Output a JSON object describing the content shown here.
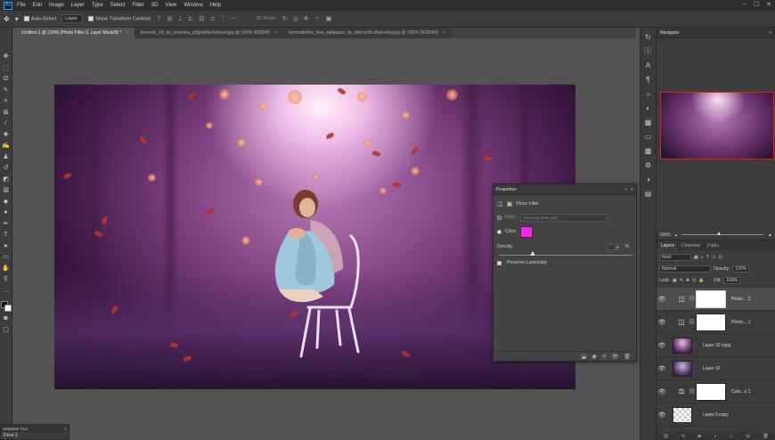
{
  "app": {
    "logo": "Ps"
  },
  "menu": [
    "File",
    "Edit",
    "Image",
    "Layer",
    "Type",
    "Select",
    "Filter",
    "3D",
    "View",
    "Window",
    "Help"
  ],
  "window_controls": [
    "–",
    "☐",
    "✕"
  ],
  "options": {
    "auto_select": "Auto-Select",
    "target": "Layer",
    "show_transform": "Show Transform Controls",
    "mode_3d": "3D Mode:"
  },
  "tabs": [
    {
      "label": "Untitled-1 @ 100% (Photo Filter 2, Layer Mask/8) *",
      "active": true
    },
    {
      "label": "firework_(4)_by_snoeska_d2jpeb8a-fullview.jpg @ 100% (RGB/8)",
      "active": false
    },
    {
      "label": "cinematicfire_free_wallpaper_by_bilbcart8-d5pkmrkg.jpg @ 100% (RGB/8#)",
      "active": false
    }
  ],
  "properties": {
    "title": "Properties",
    "subtitle": "Photo Filter",
    "filter_label": "Filter:",
    "filter_value": "Warming Filter (85)",
    "color_label": "Color:",
    "density_label": "Density:",
    "density_value": "25",
    "density_unit": "%",
    "density_level": 0.25,
    "preserve": "Preserve Luminosity",
    "color_hex": "#ff22ee"
  },
  "navigator": {
    "title": "Navigator",
    "zoom": "100%"
  },
  "layers_panel": {
    "tabs": [
      "Layers",
      "Channels",
      "Paths"
    ],
    "kind": "Kind",
    "blend": "Normal",
    "opacity_label": "Opacity:",
    "opacity": "100%",
    "lock_label": "Lock:",
    "fill_label": "Fill:",
    "fill": "100%",
    "layers": [
      {
        "name": "Photo... 2",
        "type": "adjustment",
        "active": true
      },
      {
        "name": "Photo... 1",
        "type": "adjustment",
        "active": false
      },
      {
        "name": "Layer 10 copy",
        "type": "image",
        "active": false
      },
      {
        "name": "Layer 10",
        "type": "image",
        "active": false
      },
      {
        "name": "Colo...a 1",
        "type": "adjustment2",
        "active": false
      },
      {
        "name": "Layer 9 copy",
        "type": "transparent",
        "active": false
      }
    ]
  },
  "float_panel": {
    "title": "Selective Tool",
    "value": "Drive 2"
  }
}
